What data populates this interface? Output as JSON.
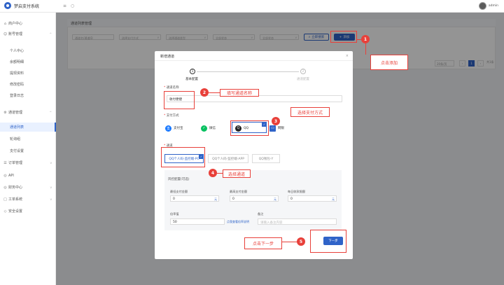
{
  "app": {
    "title": "梦启支付系统",
    "username": "admin"
  },
  "sidebar": {
    "items": [
      {
        "label": "商户中心",
        "icon": "home-icon",
        "chevron": false
      },
      {
        "label": "账号管理",
        "icon": "user-icon",
        "chevron": true
      },
      {
        "label": "个人中心",
        "sub": true
      },
      {
        "label": "余额明细",
        "sub": true
      },
      {
        "label": "提现资料",
        "sub": true
      },
      {
        "label": "修改密码",
        "sub": true
      },
      {
        "label": "登录日志",
        "sub": true
      },
      {
        "label": "通道管理",
        "icon": "channel-icon",
        "chevron": true
      },
      {
        "label": "通道列表",
        "sub": true,
        "active": true
      },
      {
        "label": "轮询组",
        "sub": true
      },
      {
        "label": "支付设置",
        "sub": true
      },
      {
        "label": "订单管理",
        "icon": "order-icon",
        "chevron": true
      },
      {
        "label": "API",
        "icon": "api-icon",
        "chevron": false
      },
      {
        "label": "财务中心",
        "icon": "finance-icon",
        "chevron": true
      },
      {
        "label": "工单系统",
        "icon": "ticket-icon",
        "chevron": true
      },
      {
        "label": "安全设置",
        "icon": "shield-icon",
        "chevron": false
      }
    ]
  },
  "list": {
    "title": "通道列表管理",
    "filters": [
      "通道名/通道ID",
      "选择支付方式",
      "选择通道类型",
      "全部状态",
      "全部状态"
    ],
    "search_label": "立即搜索",
    "add_label": "添加",
    "page_size": "20条/页",
    "page_current": "1",
    "page_total": "共1条"
  },
  "modal": {
    "title": "新增通道",
    "close": "×",
    "steps": [
      {
        "num": "1",
        "label": "基本配置"
      },
      {
        "num": "2",
        "label": "通道配置"
      }
    ],
    "name_label": "通道名称",
    "name_value": "收付便捷",
    "pay_label": "支付方式",
    "pay_options": [
      {
        "label": "支付宝",
        "color": "#1677ff"
      },
      {
        "label": "微信",
        "color": "#07c160"
      },
      {
        "label": "QQ",
        "color": "#222222"
      },
      {
        "label": "网银",
        "color": "#2f63c8"
      }
    ],
    "channel_label": "通道",
    "channels": [
      "QQ个人码-监控端-PC",
      "QQ个人码-监控端-APP",
      "QQ钱包-Y"
    ],
    "risk_title": "风控配置(可选)",
    "risk_fields": {
      "single_min_label": "最低支付金额",
      "single_min_value": "0",
      "single_max_label": "最高支付金额",
      "single_max_value": "0",
      "daily_label": "每日收款限额",
      "daily_value": "0",
      "unit": "元",
      "rate_label": "倍率值",
      "rate_value": "50",
      "rate_link": "点我查看倍率说明",
      "remark_label": "备注",
      "remark_placeholder": "请输入备注内容"
    },
    "next_label": "下一步"
  },
  "annotations": [
    {
      "num": "1",
      "text": "点击添加"
    },
    {
      "num": "2",
      "text": "填写通道名称"
    },
    {
      "num": "3",
      "text": "选择支付方式"
    },
    {
      "num": "4",
      "text": "选择通道"
    },
    {
      "num": "5",
      "text": "点击下一步"
    }
  ]
}
